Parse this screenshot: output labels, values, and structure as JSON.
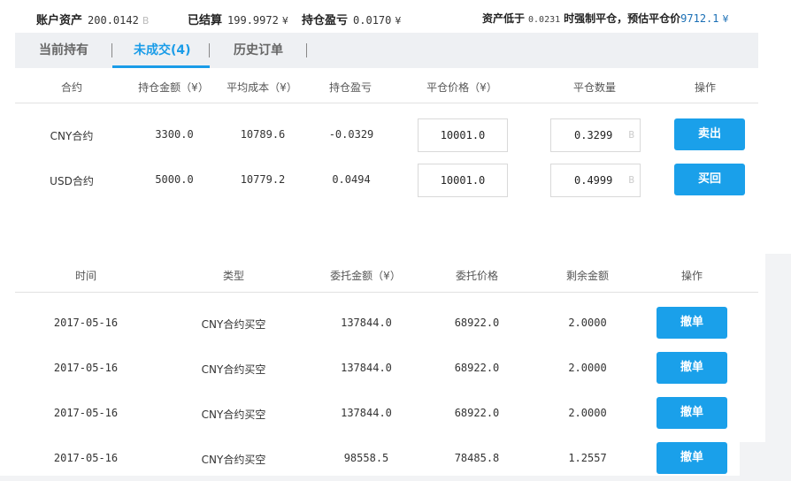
{
  "summary": {
    "assets_label": "账户资产",
    "assets_value": "200.0142",
    "assets_unit": "B",
    "settled_label": "已结算",
    "settled_value": "199.9972",
    "settled_unit": "¥",
    "pnl_label": "持仓盈亏",
    "pnl_value": "0.0170",
    "pnl_unit": "¥",
    "liq_prefix": "资产低于",
    "liq_threshold": "0.0231",
    "liq_middle": "时强制平仓，预估平仓价",
    "liq_price": "9712.1",
    "liq_unit": "¥"
  },
  "tabs": [
    {
      "label": "当前持有",
      "active": false
    },
    {
      "label": "未成交(4)",
      "active": true
    },
    {
      "label": "历史订单",
      "active": false
    }
  ],
  "positions": {
    "headers": [
      "合约",
      "持仓金额（¥）",
      "平均成本（¥）",
      "持仓盈亏",
      "平仓价格（¥）",
      "平仓数量",
      "操作"
    ],
    "rows": [
      {
        "contract": "CNY合约",
        "amount": "3300.0",
        "avg_cost": "10789.6",
        "pnl": "-0.0329",
        "close_price": "10001.0",
        "close_qty": "0.3299",
        "qty_unit": "B",
        "action": "卖出"
      },
      {
        "contract": "USD合约",
        "amount": "5000.0",
        "avg_cost": "10779.2",
        "pnl": "0.0494",
        "close_price": "10001.0",
        "close_qty": "0.4999",
        "qty_unit": "B",
        "action": "买回"
      }
    ]
  },
  "orders": {
    "headers": [
      "时间",
      "类型",
      "委托金额（¥）",
      "委托价格",
      "剩余金额",
      "操作"
    ],
    "rows": [
      {
        "time": "2017-05-16",
        "type": "CNY合约买空",
        "amount": "137844.0",
        "price": "68922.0",
        "remaining": "2.0000",
        "action": "撤单"
      },
      {
        "time": "2017-05-16",
        "type": "CNY合约买空",
        "amount": "137844.0",
        "price": "68922.0",
        "remaining": "2.0000",
        "action": "撤单"
      },
      {
        "time": "2017-05-16",
        "type": "CNY合约买空",
        "amount": "137844.0",
        "price": "68922.0",
        "remaining": "2.0000",
        "action": "撤单"
      },
      {
        "time": "2017-05-16",
        "type": "CNY合约买空",
        "amount": "98558.5",
        "price": "78485.8",
        "remaining": "1.2557",
        "action": "撤单"
      }
    ]
  },
  "colors": {
    "accent": "#1aa0ea",
    "tab_active": "#1a9ce8",
    "tab_bar_bg": "#eef0f3",
    "price_blue": "#1a6fb5"
  }
}
